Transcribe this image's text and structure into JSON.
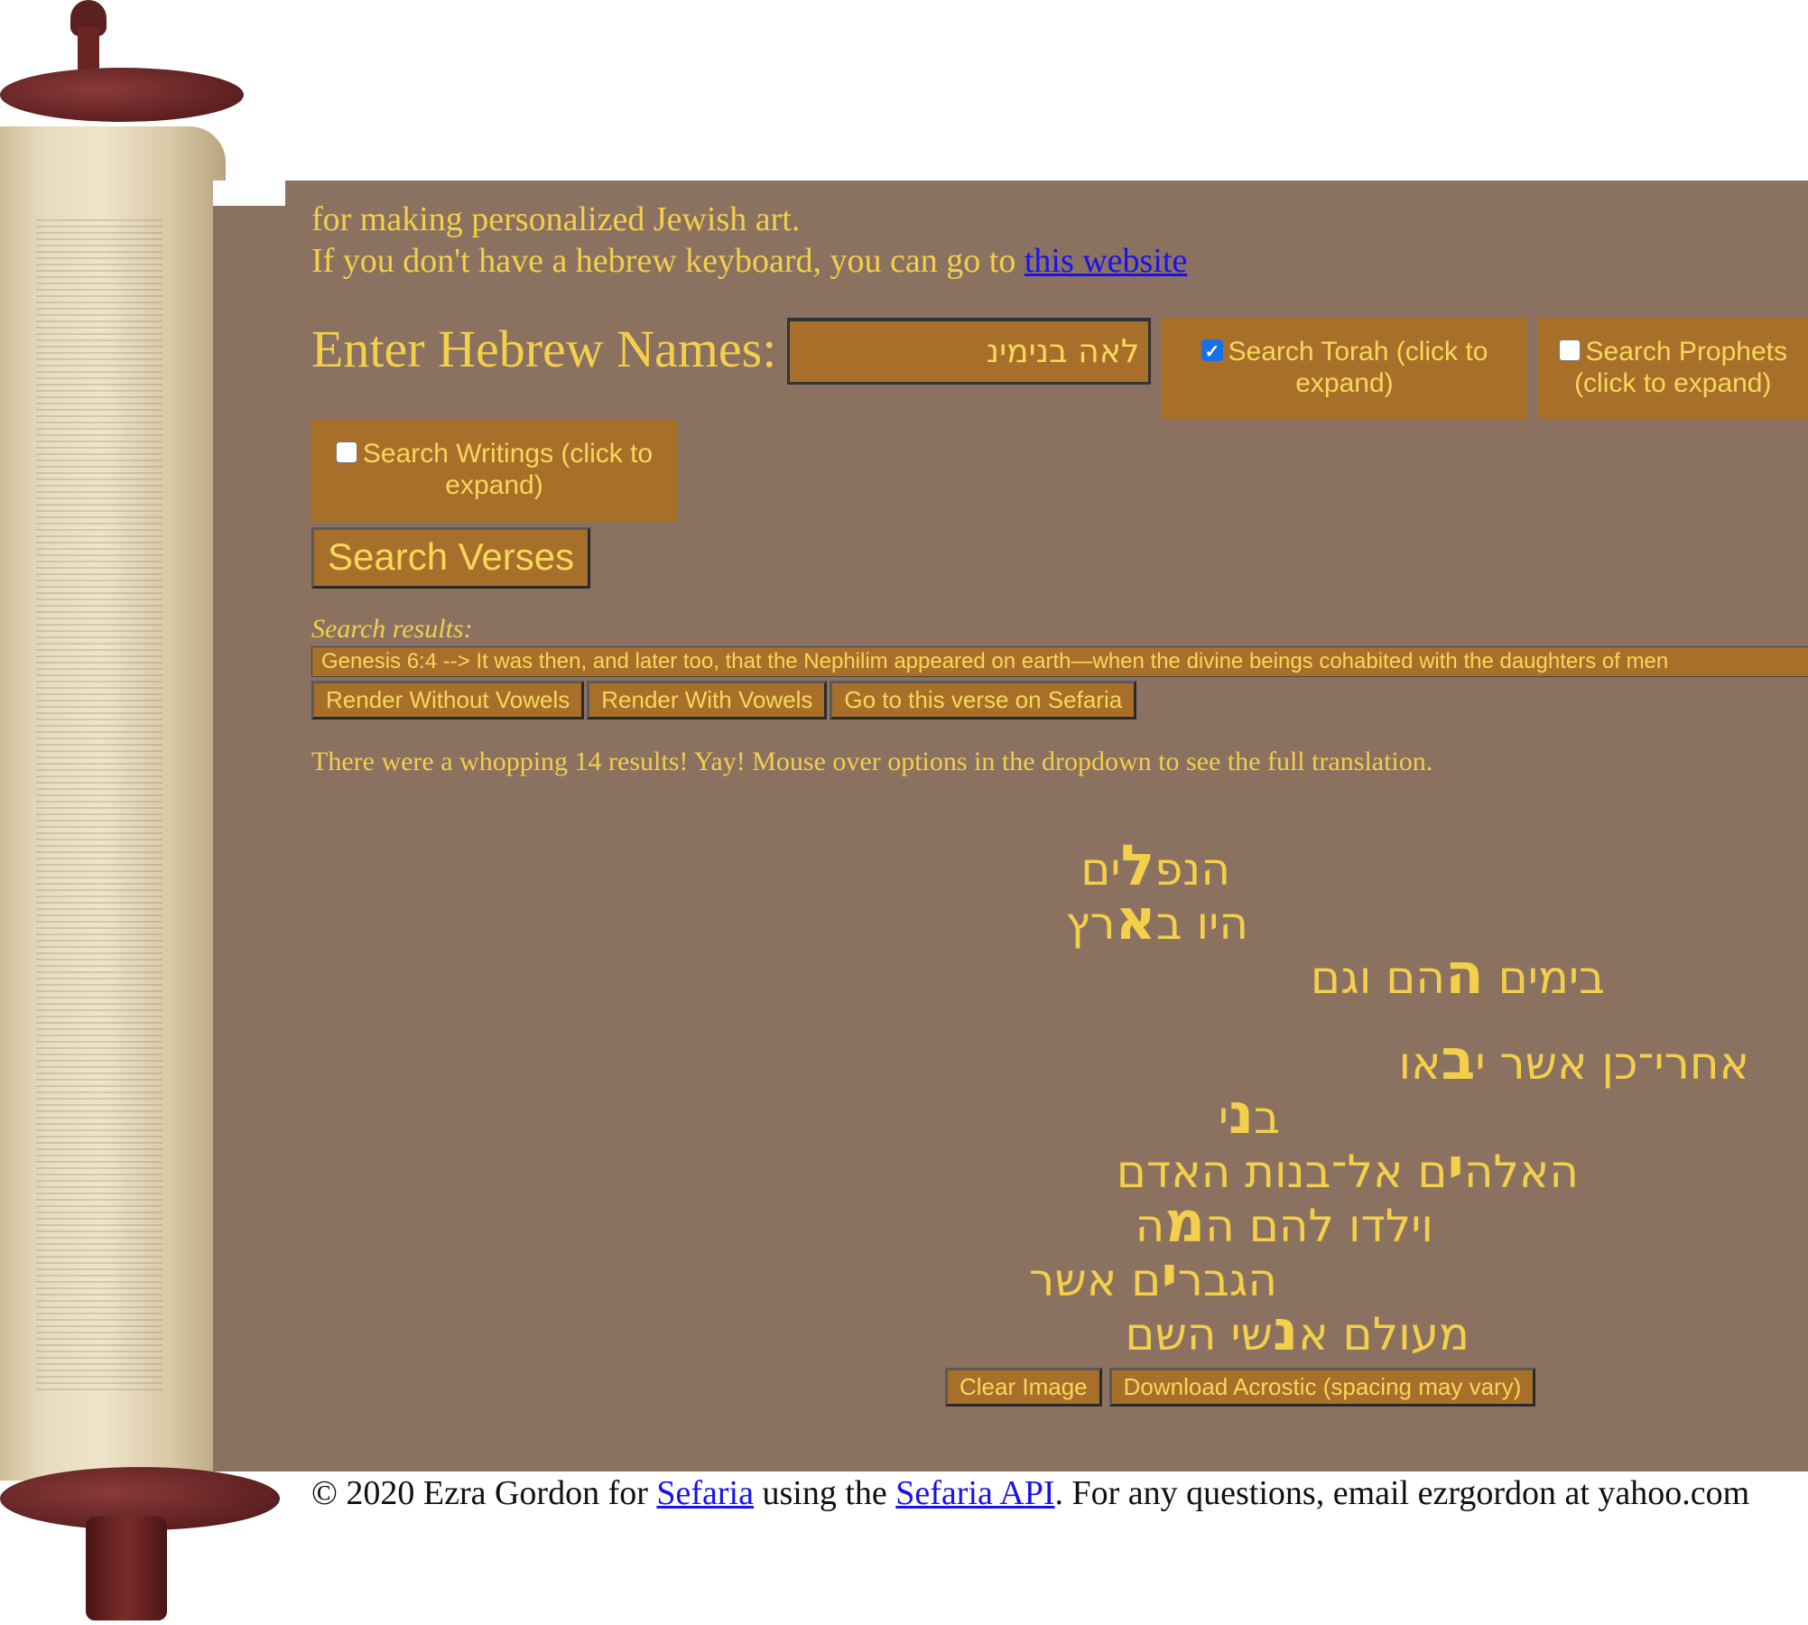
{
  "intro": {
    "line1": "for making personalized Jewish art.",
    "line2_prefix": "If you don't have a hebrew keyboard, you can go to ",
    "line2_link": "this website"
  },
  "form": {
    "names_label": "Enter Hebrew Names:",
    "names_value": "לאה בנימינ",
    "torah_label": "Search Torah (click to expand)",
    "torah_checked": true,
    "prophets_label": "Search Prophets (click to expand)",
    "prophets_checked": false,
    "writings_label": "Search Writings (click to expand)",
    "writings_checked": false,
    "search_button": "Search Verses"
  },
  "results": {
    "label": "Search results:",
    "selected": "Genesis 6:4 --> It was then, and later too, that the Nephilim appeared on earth—when the divine beings cohabited with the daughters of men",
    "buttons": {
      "without_vowels": "Render Without Vowels",
      "with_vowels": "Render With Vowels",
      "sefaria": "Go to this verse on Sefaria"
    },
    "summary": "There were a whopping 14 results! Yay! Mouse over options in the dropdown to see the full translation."
  },
  "acrostic": {
    "lines": [
      {
        "before": "הנפ",
        "letter": "ל",
        "after": "ים"
      },
      {
        "before": "היו ב",
        "letter": "א",
        "after": "רץ"
      },
      {
        "before": "בימים ",
        "letter": "ה",
        "after": "הם וגם"
      },
      {
        "before": "אחרי־כן אשר י",
        "letter": "ב",
        "after": "או"
      },
      {
        "before": "ב",
        "letter": "נ",
        "after": "י"
      },
      {
        "before": "האלה",
        "letter": "י",
        "after": "ם אל־בנות האדם"
      },
      {
        "before": "וילדו להם ה",
        "letter": "מ",
        "after": "ה"
      },
      {
        "before": "הגבר",
        "letter": "י",
        "after": "ם אשר"
      },
      {
        "before": "מעולם א",
        "letter": "נ",
        "after": "שי השם"
      }
    ],
    "clear_button": "Clear Image",
    "download_button": "Download Acrostic (spacing may vary)"
  },
  "footer": {
    "prefix": "© 2020 Ezra Gordon for ",
    "link1": "Sefaria",
    "middle": " using the ",
    "link2": "Sefaria API",
    "suffix": ". For any questions, email ezrgordon at yahoo.com"
  },
  "colors": {
    "panel": "#8b7260",
    "accent": "#f3cf4b",
    "button": "#a86f2a"
  }
}
